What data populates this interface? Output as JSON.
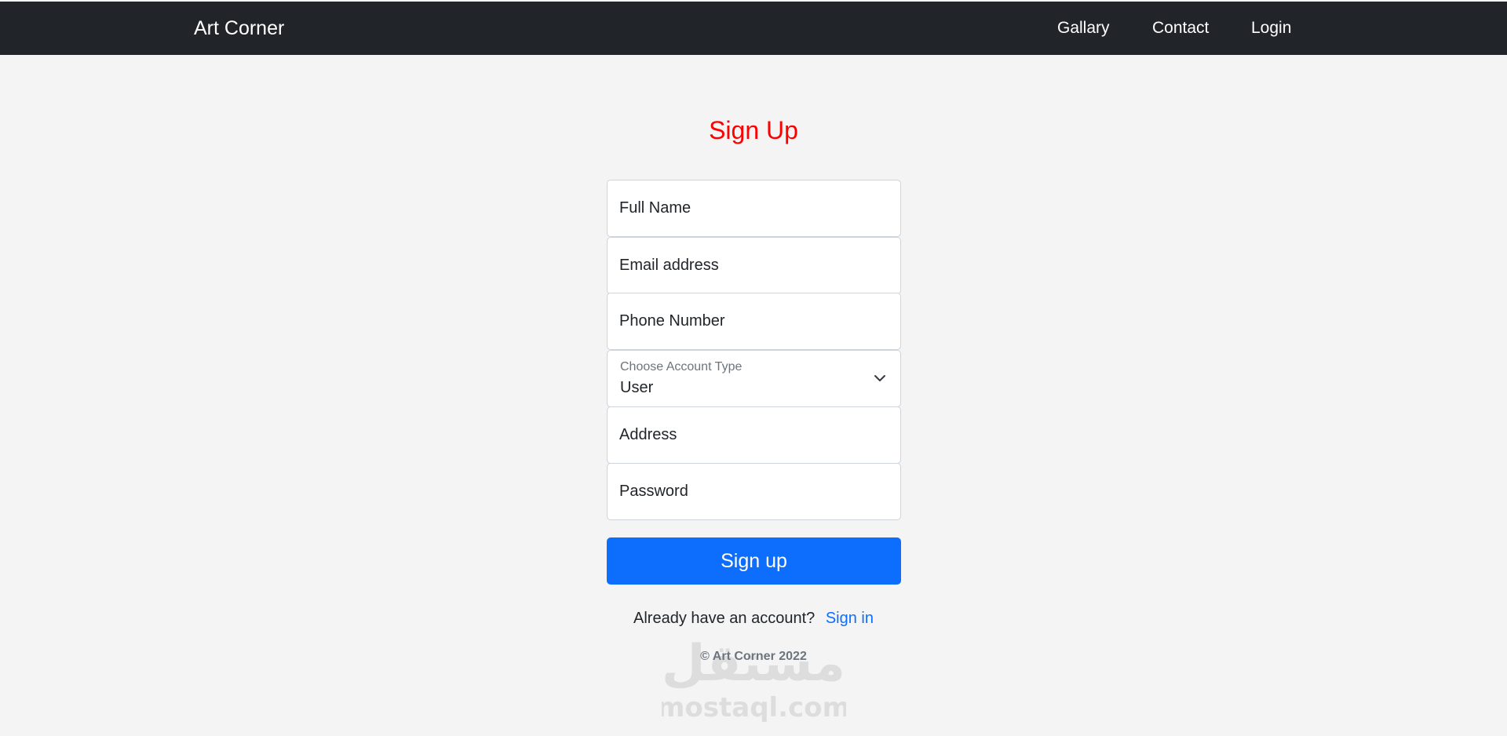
{
  "navbar": {
    "brand": "Art Corner",
    "links": [
      "Gallary",
      "Contact",
      "Login"
    ]
  },
  "signup": {
    "title": "Sign Up",
    "fields": {
      "full_name_placeholder": "Full Name",
      "email_placeholder": "Email address",
      "phone_placeholder": "Phone Number",
      "address_placeholder": "Address",
      "password_placeholder": "Password"
    },
    "account_type": {
      "label": "Choose Account Type",
      "value": "User"
    },
    "submit_label": "Sign up",
    "have_account_text": "Already have an account?",
    "signin_link": "Sign in"
  },
  "footer": {
    "copyright": "© Art Corner 2022"
  },
  "watermark": {
    "arabic": "مستقل",
    "domain": "mostaql.com"
  },
  "colors": {
    "navbar_bg": "#212529",
    "title": "#ff0000",
    "primary": "#0d6efd",
    "page_bg": "#f4f4f5"
  }
}
